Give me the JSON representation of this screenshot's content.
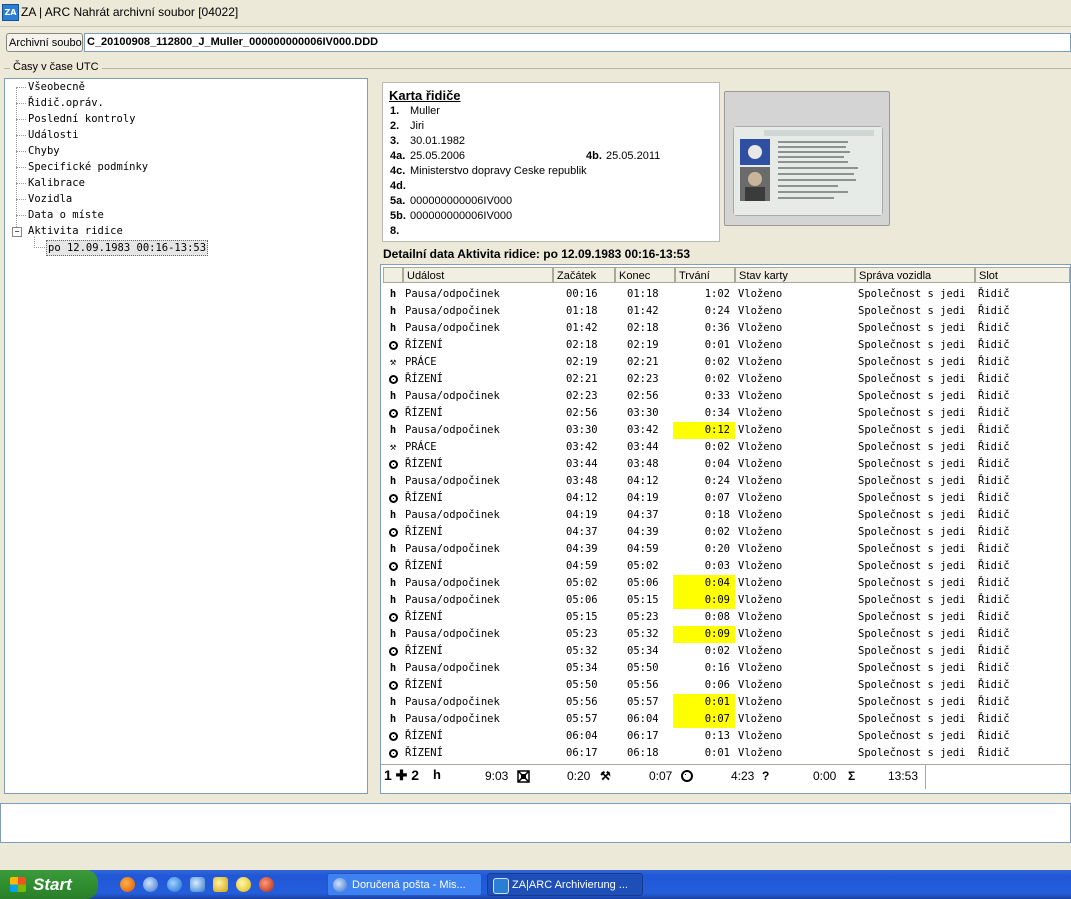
{
  "window": {
    "icon_text": "ZA",
    "title": "ZA | ARC Nahrát archivní soubor [04022]"
  },
  "file": {
    "button_label": "Archivní soubor",
    "filename": "C_20100908_112800_J_Muller_000000000006IV000.DDD"
  },
  "group_label": "Časy v čase UTC",
  "tree": {
    "items": [
      "Všeobecně",
      "Řidič.opráv.",
      "Poslední kontroly",
      "Události",
      "Chyby",
      "Specifické podmínky",
      "Kalibrace",
      "Vozidla",
      "Data o míste",
      "Aktivita ridice"
    ],
    "expander": "−",
    "child": "po 12.09.1983 00:16-13:53"
  },
  "card": {
    "title": "Karta řidiče",
    "fields": [
      {
        "label": "1.",
        "value": "Muller"
      },
      {
        "label": "2.",
        "value": "Jiri"
      },
      {
        "label": "3.",
        "value": "30.01.1982"
      },
      {
        "label": "4a.",
        "value": "25.05.2006"
      },
      {
        "label": "4c.",
        "value": "Ministerstvo dopravy Ceske republik"
      },
      {
        "label": "4d.",
        "value": ""
      },
      {
        "label": "5a.",
        "value": "000000000006IV000"
      },
      {
        "label": "5b.",
        "value": "000000000006IV000"
      },
      {
        "label": "8.",
        "value": ""
      }
    ],
    "field_4b": {
      "label": "4b.",
      "value": "25.05.2011"
    }
  },
  "detail": {
    "title": "Detailní data Aktivita ridice: po 12.09.1983 00:16-13:53",
    "columns": [
      "Událost",
      "Začátek",
      "Konec",
      "Trvání",
      "Stav karty",
      "Správa vozidla",
      "Slot"
    ],
    "rows": [
      {
        "icon": "rest",
        "event": "Pausa/odpočinek",
        "start": "00:16",
        "end": "01:18",
        "dur": "1:02",
        "card": "Vloženo",
        "veh": "Společnost s jedi",
        "slot": "Řidič",
        "hl": false
      },
      {
        "icon": "rest",
        "event": "Pausa/odpočinek",
        "start": "01:18",
        "end": "01:42",
        "dur": "0:24",
        "card": "Vloženo",
        "veh": "Společnost s jedi",
        "slot": "Řidič",
        "hl": false
      },
      {
        "icon": "rest",
        "event": "Pausa/odpočinek",
        "start": "01:42",
        "end": "02:18",
        "dur": "0:36",
        "card": "Vloženo",
        "veh": "Společnost s jedi",
        "slot": "Řidič",
        "hl": false
      },
      {
        "icon": "drive",
        "event": "ŘÍZENÍ",
        "start": "02:18",
        "end": "02:19",
        "dur": "0:01",
        "card": "Vloženo",
        "veh": "Společnost s jedi",
        "slot": "Řidič",
        "hl": false
      },
      {
        "icon": "work",
        "event": "PRÁCE",
        "start": "02:19",
        "end": "02:21",
        "dur": "0:02",
        "card": "Vloženo",
        "veh": "Společnost s jedi",
        "slot": "Řidič",
        "hl": false
      },
      {
        "icon": "drive",
        "event": "ŘÍZENÍ",
        "start": "02:21",
        "end": "02:23",
        "dur": "0:02",
        "card": "Vloženo",
        "veh": "Společnost s jedi",
        "slot": "Řidič",
        "hl": false
      },
      {
        "icon": "rest",
        "event": "Pausa/odpočinek",
        "start": "02:23",
        "end": "02:56",
        "dur": "0:33",
        "card": "Vloženo",
        "veh": "Společnost s jedi",
        "slot": "Řidič",
        "hl": false
      },
      {
        "icon": "drive",
        "event": "ŘÍZENÍ",
        "start": "02:56",
        "end": "03:30",
        "dur": "0:34",
        "card": "Vloženo",
        "veh": "Společnost s jedi",
        "slot": "Řidič",
        "hl": false
      },
      {
        "icon": "rest",
        "event": "Pausa/odpočinek",
        "start": "03:30",
        "end": "03:42",
        "dur": "0:12",
        "card": "Vloženo",
        "veh": "Společnost s jedi",
        "slot": "Řidič",
        "hl": true
      },
      {
        "icon": "work",
        "event": "PRÁCE",
        "start": "03:42",
        "end": "03:44",
        "dur": "0:02",
        "card": "Vloženo",
        "veh": "Společnost s jedi",
        "slot": "Řidič",
        "hl": false
      },
      {
        "icon": "drive",
        "event": "ŘÍZENÍ",
        "start": "03:44",
        "end": "03:48",
        "dur": "0:04",
        "card": "Vloženo",
        "veh": "Společnost s jedi",
        "slot": "Řidič",
        "hl": false
      },
      {
        "icon": "rest",
        "event": "Pausa/odpočinek",
        "start": "03:48",
        "end": "04:12",
        "dur": "0:24",
        "card": "Vloženo",
        "veh": "Společnost s jedi",
        "slot": "Řidič",
        "hl": false
      },
      {
        "icon": "drive",
        "event": "ŘÍZENÍ",
        "start": "04:12",
        "end": "04:19",
        "dur": "0:07",
        "card": "Vloženo",
        "veh": "Společnost s jedi",
        "slot": "Řidič",
        "hl": false
      },
      {
        "icon": "rest",
        "event": "Pausa/odpočinek",
        "start": "04:19",
        "end": "04:37",
        "dur": "0:18",
        "card": "Vloženo",
        "veh": "Společnost s jedi",
        "slot": "Řidič",
        "hl": false
      },
      {
        "icon": "drive",
        "event": "ŘÍZENÍ",
        "start": "04:37",
        "end": "04:39",
        "dur": "0:02",
        "card": "Vloženo",
        "veh": "Společnost s jedi",
        "slot": "Řidič",
        "hl": false
      },
      {
        "icon": "rest",
        "event": "Pausa/odpočinek",
        "start": "04:39",
        "end": "04:59",
        "dur": "0:20",
        "card": "Vloženo",
        "veh": "Společnost s jedi",
        "slot": "Řidič",
        "hl": false
      },
      {
        "icon": "drive",
        "event": "ŘÍZENÍ",
        "start": "04:59",
        "end": "05:02",
        "dur": "0:03",
        "card": "Vloženo",
        "veh": "Společnost s jedi",
        "slot": "Řidič",
        "hl": false
      },
      {
        "icon": "rest",
        "event": "Pausa/odpočinek",
        "start": "05:02",
        "end": "05:06",
        "dur": "0:04",
        "card": "Vloženo",
        "veh": "Společnost s jedi",
        "slot": "Řidič",
        "hl": true
      },
      {
        "icon": "rest",
        "event": "Pausa/odpočinek",
        "start": "05:06",
        "end": "05:15",
        "dur": "0:09",
        "card": "Vloženo",
        "veh": "Společnost s jedi",
        "slot": "Řidič",
        "hl": true
      },
      {
        "icon": "drive",
        "event": "ŘÍZENÍ",
        "start": "05:15",
        "end": "05:23",
        "dur": "0:08",
        "card": "Vloženo",
        "veh": "Společnost s jedi",
        "slot": "Řidič",
        "hl": false
      },
      {
        "icon": "rest",
        "event": "Pausa/odpočinek",
        "start": "05:23",
        "end": "05:32",
        "dur": "0:09",
        "card": "Vloženo",
        "veh": "Společnost s jedi",
        "slot": "Řidič",
        "hl": true
      },
      {
        "icon": "drive",
        "event": "ŘÍZENÍ",
        "start": "05:32",
        "end": "05:34",
        "dur": "0:02",
        "card": "Vloženo",
        "veh": "Společnost s jedi",
        "slot": "Řidič",
        "hl": false
      },
      {
        "icon": "rest",
        "event": "Pausa/odpočinek",
        "start": "05:34",
        "end": "05:50",
        "dur": "0:16",
        "card": "Vloženo",
        "veh": "Společnost s jedi",
        "slot": "Řidič",
        "hl": false
      },
      {
        "icon": "drive",
        "event": "ŘÍZENÍ",
        "start": "05:50",
        "end": "05:56",
        "dur": "0:06",
        "card": "Vloženo",
        "veh": "Společnost s jedi",
        "slot": "Řidič",
        "hl": false
      },
      {
        "icon": "rest",
        "event": "Pausa/odpočinek",
        "start": "05:56",
        "end": "05:57",
        "dur": "0:01",
        "card": "Vloženo",
        "veh": "Společnost s jedi",
        "slot": "Řidič",
        "hl": true
      },
      {
        "icon": "rest",
        "event": "Pausa/odpočinek",
        "start": "05:57",
        "end": "06:04",
        "dur": "0:07",
        "card": "Vloženo",
        "veh": "Společnost s jedi",
        "slot": "Řidič",
        "hl": true
      },
      {
        "icon": "drive",
        "event": "ŘÍZENÍ",
        "start": "06:04",
        "end": "06:17",
        "dur": "0:13",
        "card": "Vloženo",
        "veh": "Společnost s jedi",
        "slot": "Řidič",
        "hl": false
      },
      {
        "icon": "drive",
        "event": "ŘÍZENÍ",
        "start": "06:17",
        "end": "06:18",
        "dur": "0:01",
        "card": "Vloženo",
        "veh": "Společnost s jedi",
        "slot": "Řidič",
        "hl": false
      }
    ],
    "summary": {
      "crew": "1 ✚ 2",
      "rest": "9:03",
      "avail": "0:20",
      "work": "0:07",
      "drive": "4:23",
      "unknown_icon": "?",
      "unknown": "0:00",
      "total_icon": "Σ",
      "total": "13:53"
    }
  },
  "taskbar": {
    "start": "Start",
    "tasks": [
      "Doručená pošta - Mis...",
      "ZA|ARC Archivierung ..."
    ]
  }
}
